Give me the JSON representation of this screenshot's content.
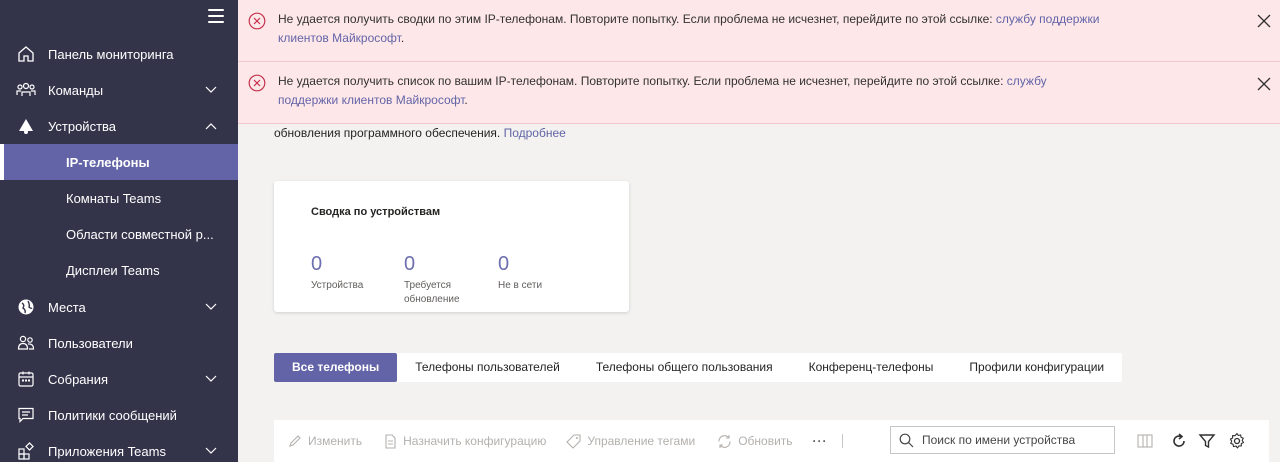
{
  "sidebar": {
    "items": [
      {
        "label": "Панель мониторинга"
      },
      {
        "label": "Команды"
      },
      {
        "label": "Устройства"
      },
      {
        "label": "IP-телефоны"
      },
      {
        "label": "Комнаты Teams"
      },
      {
        "label": "Области совместной р..."
      },
      {
        "label": "Дисплеи Teams"
      },
      {
        "label": "Места"
      },
      {
        "label": "Пользователи"
      },
      {
        "label": "Собрания"
      },
      {
        "label": "Политики сообщений"
      },
      {
        "label": "Приложения Teams"
      }
    ]
  },
  "banners": [
    {
      "text": "Не удается получить сводки по этим IP-телефонам. Повторите попытку. Если проблема не исчезнет, перейдите по этой ссылке: ",
      "link": "службу поддержки клиентов Майкрософт",
      "end": "."
    },
    {
      "text": "Не удается получить список по вашим IP-телефонам. Повторите попытку. Если проблема не исчезнет, перейдите по этой ссылке: ",
      "link": "службу поддержки клиентов Майкрософт",
      "end": "."
    }
  ],
  "description": {
    "text": "обновления программного обеспечения. ",
    "link": "Подробнее"
  },
  "summary": {
    "title": "Сводка по устройствам",
    "stats": [
      {
        "value": "0",
        "label": "Устройства"
      },
      {
        "value": "0",
        "label": "Требуется обновление"
      },
      {
        "value": "0",
        "label": "Не в сети"
      }
    ]
  },
  "tabs": [
    {
      "label": "Все телефоны",
      "active": true
    },
    {
      "label": "Телефоны пользователей"
    },
    {
      "label": "Телефоны общего пользования"
    },
    {
      "label": "Конференц-телефоны"
    },
    {
      "label": "Профили конфигурации"
    }
  ],
  "toolbar": {
    "edit": "Изменить",
    "assign": "Назначить конфигурацию",
    "tags": "Управление тегами",
    "refresh": "Обновить",
    "more": "···",
    "search_placeholder": "Поиск по имени устройства"
  },
  "colors": {
    "sidebar": "#33344a",
    "accent": "#6264a7",
    "error_bg": "#fde7e9",
    "error_icon": "#c4314b"
  }
}
